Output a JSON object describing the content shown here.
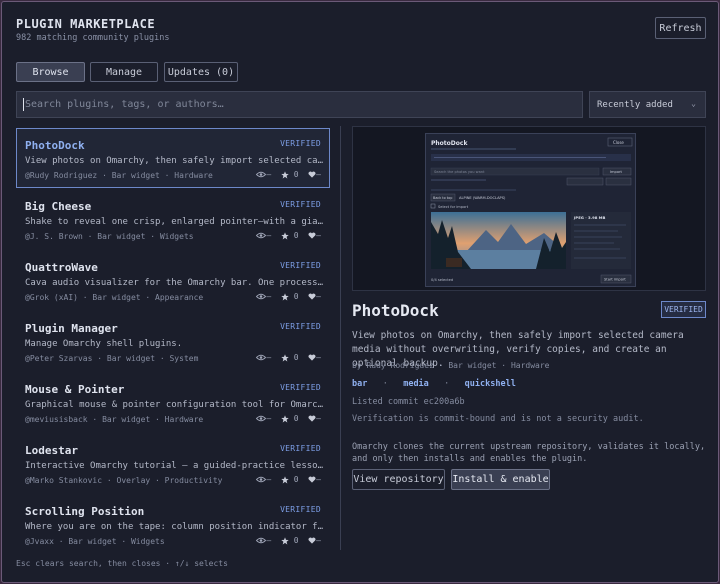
{
  "header": {
    "title": "PLUGIN MARKETPLACE",
    "subtitle": "982 matching community plugins",
    "refresh_label": "Refresh"
  },
  "tabs": [
    {
      "label": "Browse",
      "active": true
    },
    {
      "label": "Manage",
      "active": false
    },
    {
      "label": "Updates (0)",
      "active": false
    }
  ],
  "search": {
    "placeholder": "Search plugins, tags, or authors…",
    "value": ""
  },
  "sort": {
    "selected": "Recently added"
  },
  "plugins": [
    {
      "name": "PhotoDock",
      "badge": "VERIFIED",
      "desc": "View photos on Omarchy, then safely import selected camera media without overwriting",
      "meta": "@Rudy Rodriguez  ·  Bar widget  ·  Hardware",
      "views": "–",
      "stars": "0",
      "likes": "–",
      "selected": true
    },
    {
      "name": "Big Cheese",
      "badge": "VERIFIED",
      "desc": "Shake to reveal one crisp, enlarged pointer—with a giant cheese",
      "meta": "@J. S. Brown  ·  Bar widget  ·  Widgets",
      "views": "–",
      "stars": "0",
      "likes": "–",
      "selected": false
    },
    {
      "name": "QuattroWave",
      "badge": "VERIFIED",
      "desc": "Cava audio visualizer for the Omarchy bar. One process, every bar",
      "meta": "@Grok (xAI)  ·  Bar widget  ·  Appearance",
      "views": "–",
      "stars": "0",
      "likes": "–",
      "selected": false
    },
    {
      "name": "Plugin Manager",
      "badge": "VERIFIED",
      "desc": "Manage Omarchy shell plugins.",
      "meta": "@Peter Szarvas  ·  Bar widget  ·  System",
      "views": "–",
      "stars": "0",
      "likes": "–",
      "selected": false
    },
    {
      "name": "Mouse & Pointer",
      "badge": "VERIFIED",
      "desc": "Graphical mouse & pointer configuration tool for Omarchy: cursor",
      "meta": "@meviusisback  ·  Bar widget  ·  Hardware",
      "views": "–",
      "stars": "0",
      "likes": "–",
      "selected": false
    },
    {
      "name": "Lodestar",
      "badge": "VERIFIED",
      "desc": "Interactive Omarchy tutorial — a guided-practice lesson HUD",
      "meta": "@Marko Stankovic  ·  Overlay  ·  Productivity",
      "views": "–",
      "stars": "0",
      "likes": "–",
      "selected": false
    },
    {
      "name": "Scrolling Position",
      "badge": "VERIFIED",
      "desc": "Where you are on the tape: column position indicator for Hyprland",
      "meta": "@Jvaxx  ·  Bar widget  ·  Widgets",
      "views": "–",
      "stars": "0",
      "likes": "–",
      "selected": false
    }
  ],
  "footer": "Esc clears search, then closes  ·  ↑/↓ selects",
  "detail": {
    "title": "PhotoDock",
    "badge": "VERIFIED",
    "description": "View photos on Omarchy, then safely import selected camera media without overwriting, verify copies, and create an optional backup.",
    "meta": "by Rudy Rodriguez  ·  Bar widget  ·  Hardware",
    "tags": [
      "bar",
      "media",
      "quickshell"
    ],
    "commit": "Listed commit ec200a6b",
    "audit_note": "Verification is commit-bound and is not a security audit.",
    "clone_note": "Omarchy clones the current upstream repository, validates it locally, and only then installs and enables the plugin.",
    "repo_label": "View repository",
    "install_label": "Install & enable",
    "preview": {
      "title": "PhotoDock",
      "close_label": "Close",
      "import_label": "Import",
      "search_placeholder": "Search the photos you want",
      "back_label": "Back to top",
      "path_label": "ALPINE (WARM-DOCLAPS)",
      "item_label": "Select for import",
      "info_title": "JPEG · 3.98 MB",
      "footer_left": "0/4 selected",
      "footer_btn": "Start import"
    }
  }
}
